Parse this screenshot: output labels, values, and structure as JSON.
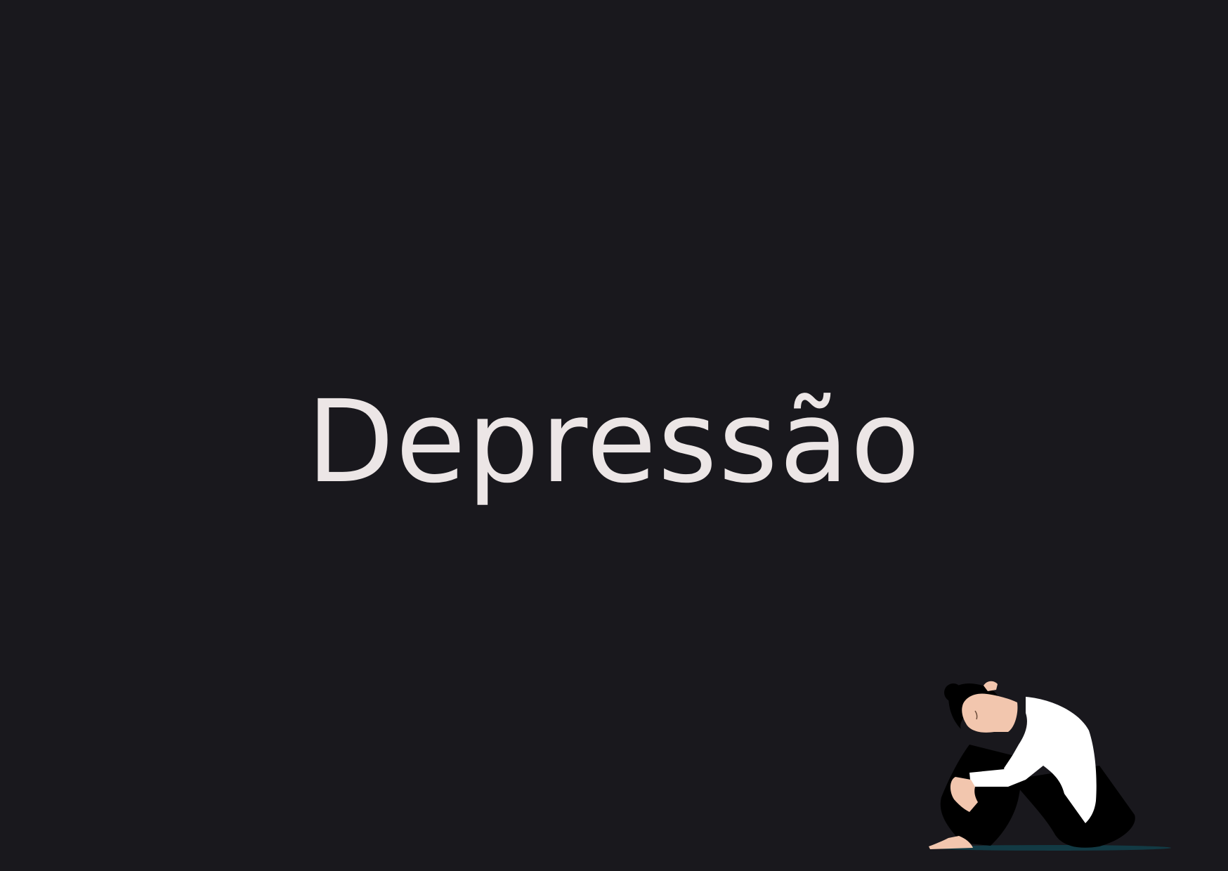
{
  "slide": {
    "title": "Depressão",
    "background_color": "#19181d",
    "title_color": "#ece6e6"
  },
  "illustration": {
    "icon": "sad-person-hugging-knees-illustration",
    "colors": {
      "skin": "#f2c6ae",
      "shirt": "#ffffff",
      "pants": "#000000",
      "hair": "#000000",
      "floor_shadow": "#123a44"
    }
  }
}
